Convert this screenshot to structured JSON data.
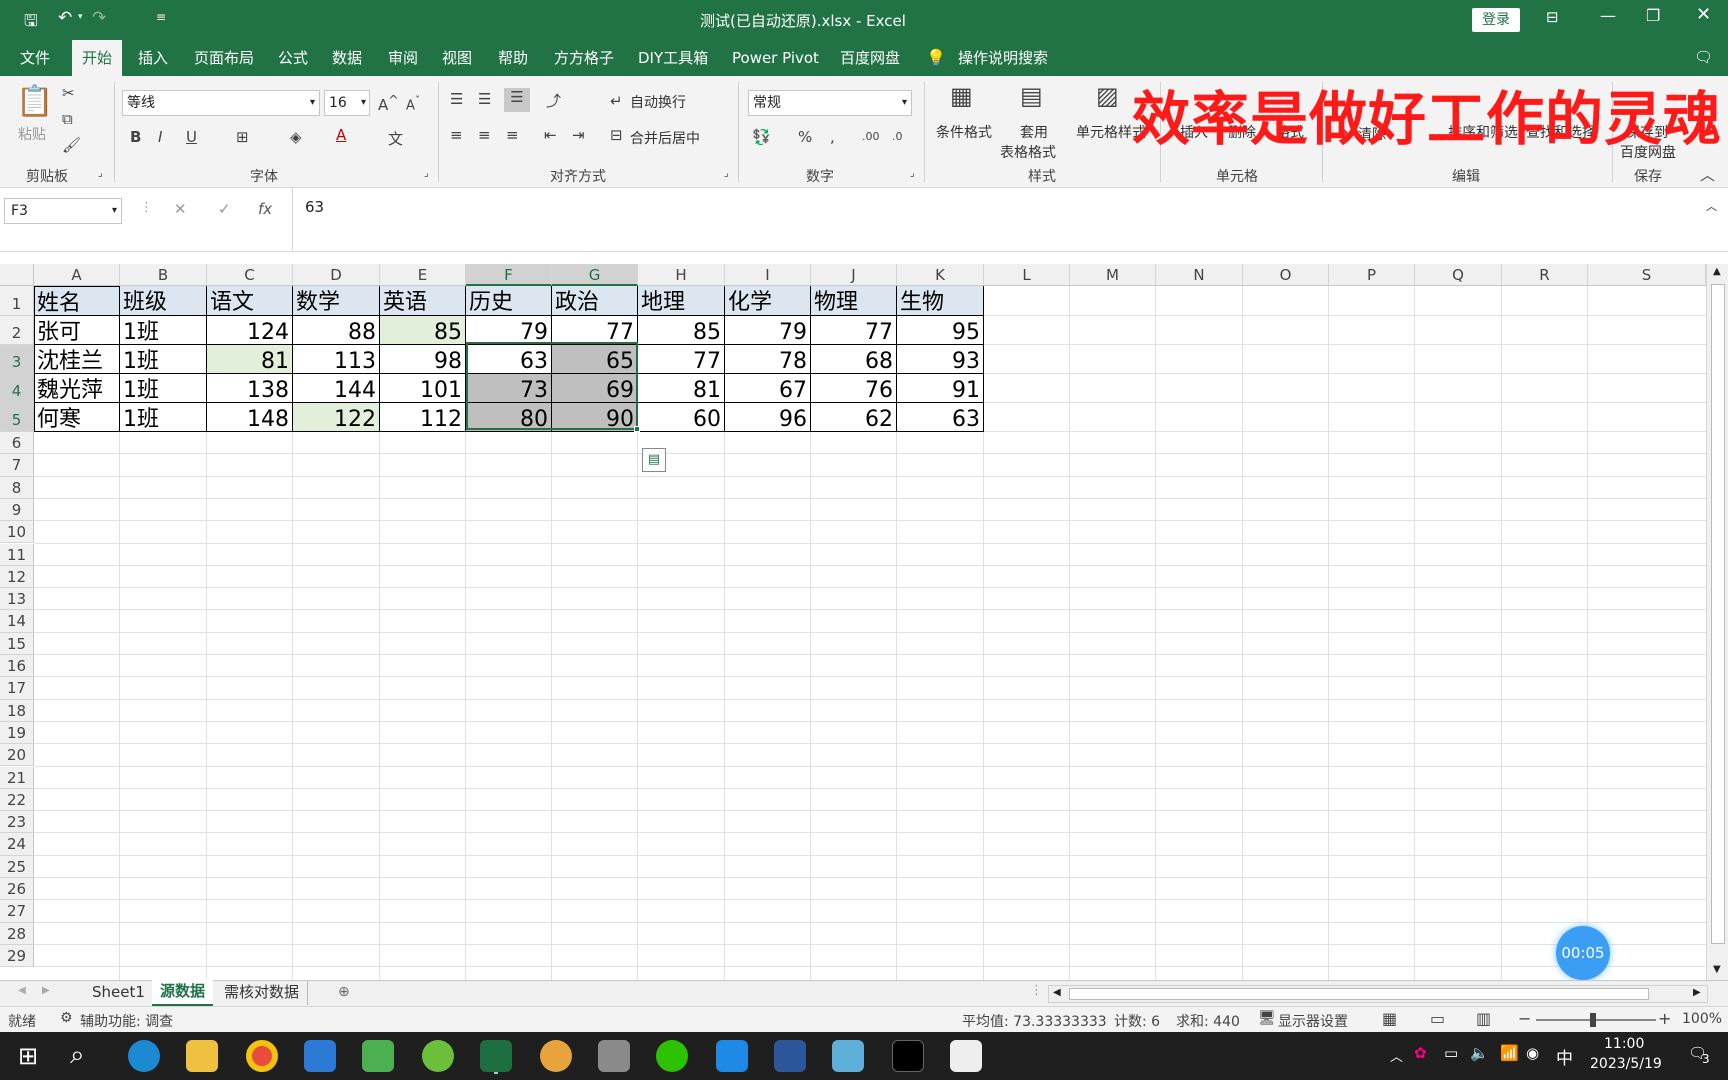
{
  "titlebar": {
    "title": "测试(已自动还原).xlsx  -  Excel",
    "login": "登录"
  },
  "tabs": [
    "文件",
    "开始",
    "插入",
    "页面布局",
    "公式",
    "数据",
    "审阅",
    "视图",
    "帮助",
    "方方格子",
    "DIY工具箱",
    "Power Pivot",
    "百度网盘",
    "操作说明搜索"
  ],
  "overlay_text": "效率是做好工作的灵魂",
  "ribbon": {
    "paste": "粘贴",
    "font_name": "等线",
    "font_size": "16",
    "wrap": "自动换行",
    "merge": "合并后居中",
    "number_format": "常规",
    "cond_format": "条件格式",
    "table_format_1": "套用",
    "table_format_2": "表格格式",
    "cell_style": "单元格样式",
    "insert": "插入",
    "delete": "删除",
    "format": "格式",
    "clear": "清除",
    "sort": "排序和筛选",
    "find": "查找和选择",
    "save_baidu_1": "保存到",
    "save_baidu_2": "百度网盘",
    "groups": [
      "剪贴板",
      "字体",
      "对齐方式",
      "数字",
      "样式",
      "单元格",
      "编辑",
      "保存"
    ]
  },
  "formula": {
    "namebox": "F3",
    "value": "63",
    "fx": "fx"
  },
  "columns": [
    "A",
    "B",
    "C",
    "D",
    "E",
    "F",
    "G",
    "H",
    "I",
    "J",
    "K",
    "L",
    "M",
    "N",
    "O",
    "P",
    "Q",
    "R",
    "S"
  ],
  "rows": [
    "1",
    "2",
    "3",
    "4",
    "5",
    "6",
    "7",
    "8",
    "9",
    "10",
    "11",
    "12",
    "13",
    "14",
    "15",
    "16",
    "17",
    "18",
    "19",
    "20",
    "21",
    "22",
    "23",
    "24",
    "25",
    "26",
    "27",
    "28",
    "29"
  ],
  "table": {
    "headers": [
      "姓名",
      "班级",
      "语文",
      "数学",
      "英语",
      "历史",
      "政治",
      "地理",
      "化学",
      "物理",
      "生物"
    ],
    "data": [
      [
        "张可",
        "1班",
        "124",
        "88",
        "85",
        "79",
        "77",
        "85",
        "79",
        "77",
        "95"
      ],
      [
        "沈桂兰",
        "1班",
        "81",
        "113",
        "98",
        "63",
        "65",
        "77",
        "78",
        "68",
        "93"
      ],
      [
        "魏光萍",
        "1班",
        "138",
        "144",
        "101",
        "73",
        "69",
        "81",
        "67",
        "76",
        "91"
      ],
      [
        "何寒",
        "1班",
        "148",
        "122",
        "112",
        "80",
        "90",
        "60",
        "96",
        "62",
        "63"
      ]
    ]
  },
  "sheet_tabs": [
    "Sheet1",
    "源数据",
    "需核对数据"
  ],
  "timer": "00:05",
  "status": {
    "ready": "就绪",
    "accessibility": "辅助功能: 调查",
    "avg": "平均值: 73.33333333",
    "count": "计数: 6",
    "sum": "求和: 440",
    "display": "显示器设置",
    "zoom": "100%"
  },
  "taskbar": {
    "ime": "中",
    "time": "11:00",
    "date": "2023/5/19",
    "notif": "3"
  },
  "colors": {
    "excel_green": "#217346",
    "header_fill": "#dce6f1",
    "green_fill": "#e2efda",
    "gray_fill": "#bfbfbf",
    "overlay_red": "#ff1a1a"
  }
}
